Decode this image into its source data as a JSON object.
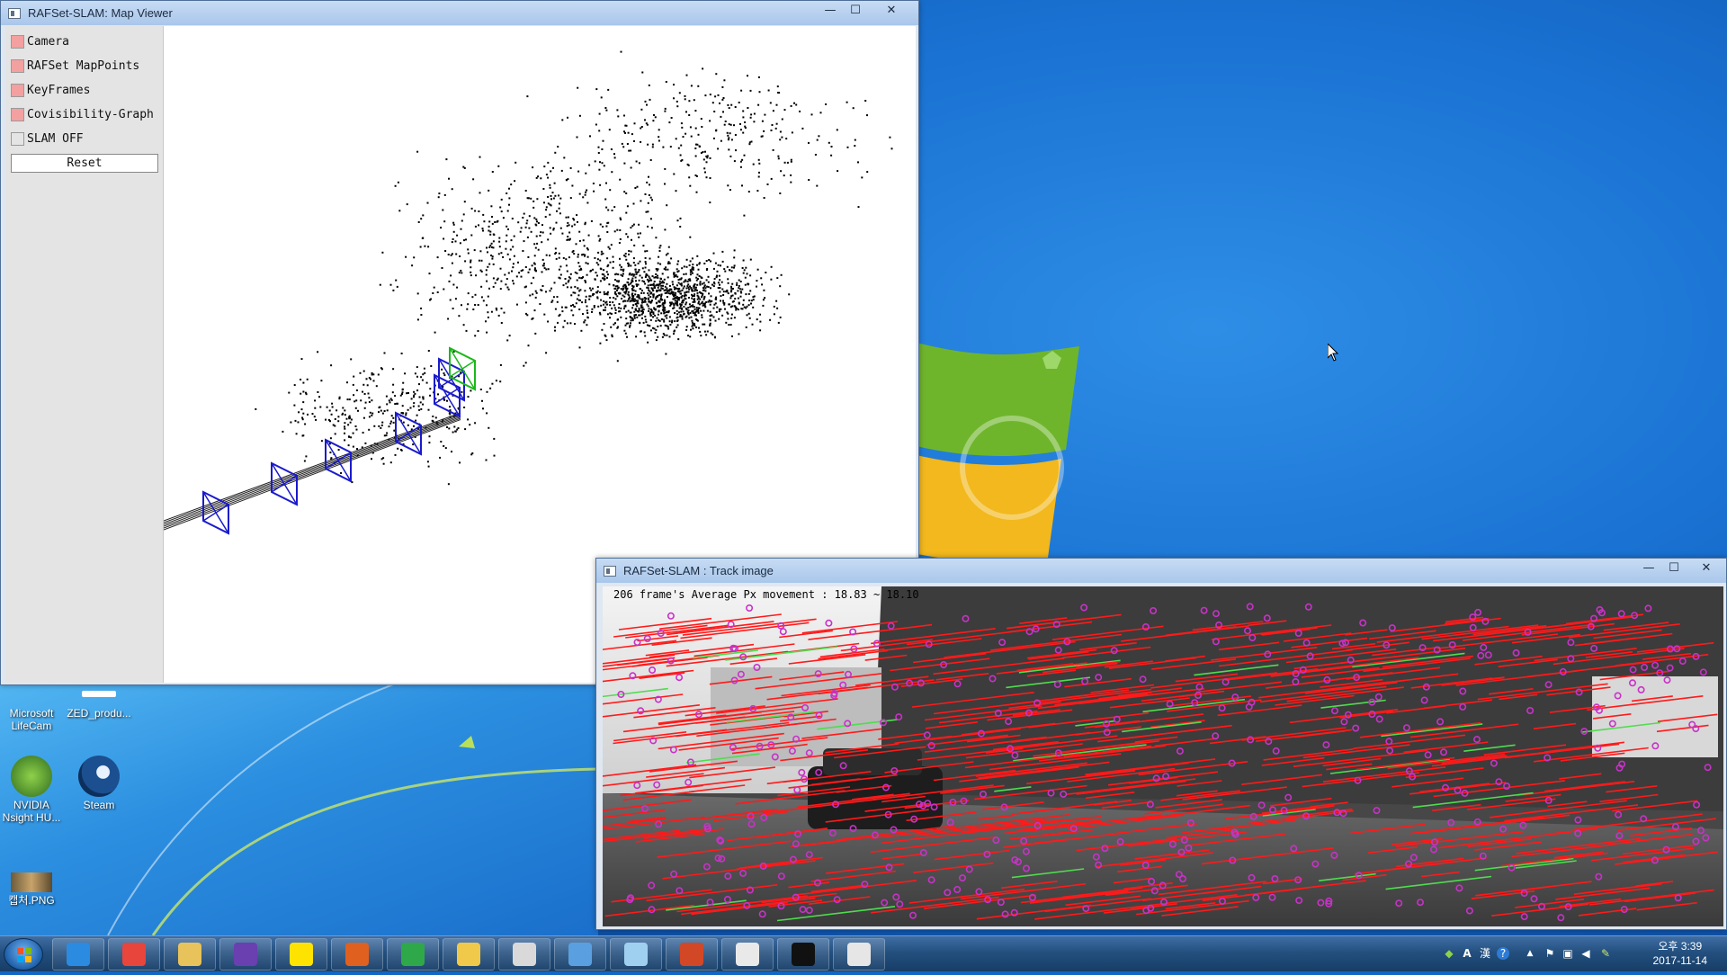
{
  "colors": {
    "map_point": "#000000",
    "keyframe": "#1a1acc",
    "current_camera": "#19b819",
    "track_line": "#ff1a1a",
    "track_line_good": "#4fdc4f",
    "track_point": "#c832c8",
    "checkbox_on": "#f3a0a0"
  },
  "map_viewer": {
    "title": "RAFSet-SLAM: Map Viewer",
    "controls": {
      "minimize": "—",
      "maximize": "☐",
      "close": "✕"
    },
    "panel": {
      "checkboxes": [
        {
          "label": "Camera",
          "checked": true
        },
        {
          "label": "RAFSet MapPoints",
          "checked": true
        },
        {
          "label": "KeyFrames",
          "checked": true
        },
        {
          "label": "Covisibility-Graph",
          "checked": true
        },
        {
          "label": "SLAM OFF",
          "checked": false
        }
      ],
      "reset_label": "Reset"
    }
  },
  "desktop_icons": [
    {
      "label": "Microsoft LifeCam",
      "icon": "lifecam-icon"
    },
    {
      "label": "ZED_produ...",
      "icon": "zed-icon"
    },
    {
      "label": "NVIDIA Nsight HU...",
      "icon": "nvidia-nsight-icon"
    },
    {
      "label": "Steam",
      "icon": "steam-icon"
    },
    {
      "label": "캡처.PNG",
      "icon": "image-file-icon"
    }
  ],
  "track_window": {
    "title": "RAFSet-SLAM : Track image",
    "controls": {
      "minimize": "—",
      "maximize": "☐",
      "close": "✕"
    },
    "overlay_text": "206 frame's Average Px movement : 18.83 ~ 18.10"
  },
  "taskbar": {
    "pinned": [
      {
        "name": "internet-explorer-icon",
        "color": "#2b8be0"
      },
      {
        "name": "chrome-icon",
        "color": "#e8453c"
      },
      {
        "name": "file-explorer-icon",
        "color": "#e8c25a"
      },
      {
        "name": "visual-studio-icon",
        "color": "#6a3fb0"
      },
      {
        "name": "kakaotalk-icon",
        "color": "#ffe300"
      },
      {
        "name": "matlab-icon",
        "color": "#e0601f"
      },
      {
        "name": "green-app-icon",
        "color": "#2fa84a"
      },
      {
        "name": "folder-icon",
        "color": "#f0c84a"
      },
      {
        "name": "snipping-tool-icon",
        "color": "#d9d9d9"
      },
      {
        "name": "network-app-icon",
        "color": "#5aa0e0"
      },
      {
        "name": "notes-icon",
        "color": "#9fd0f0"
      },
      {
        "name": "powerpoint-icon",
        "color": "#d24726"
      },
      {
        "name": "paint-icon",
        "color": "#e9e9e9"
      },
      {
        "name": "cmd-icon",
        "color": "#111111"
      },
      {
        "name": "slam-viewer-icon",
        "color": "#e6e6e6"
      }
    ],
    "tray": {
      "ime_a": "A",
      "ime_han": "漢",
      "help": "?",
      "arrow": "▲"
    },
    "clock": {
      "time": "오후 3:39",
      "date": "2017-11-14"
    }
  }
}
